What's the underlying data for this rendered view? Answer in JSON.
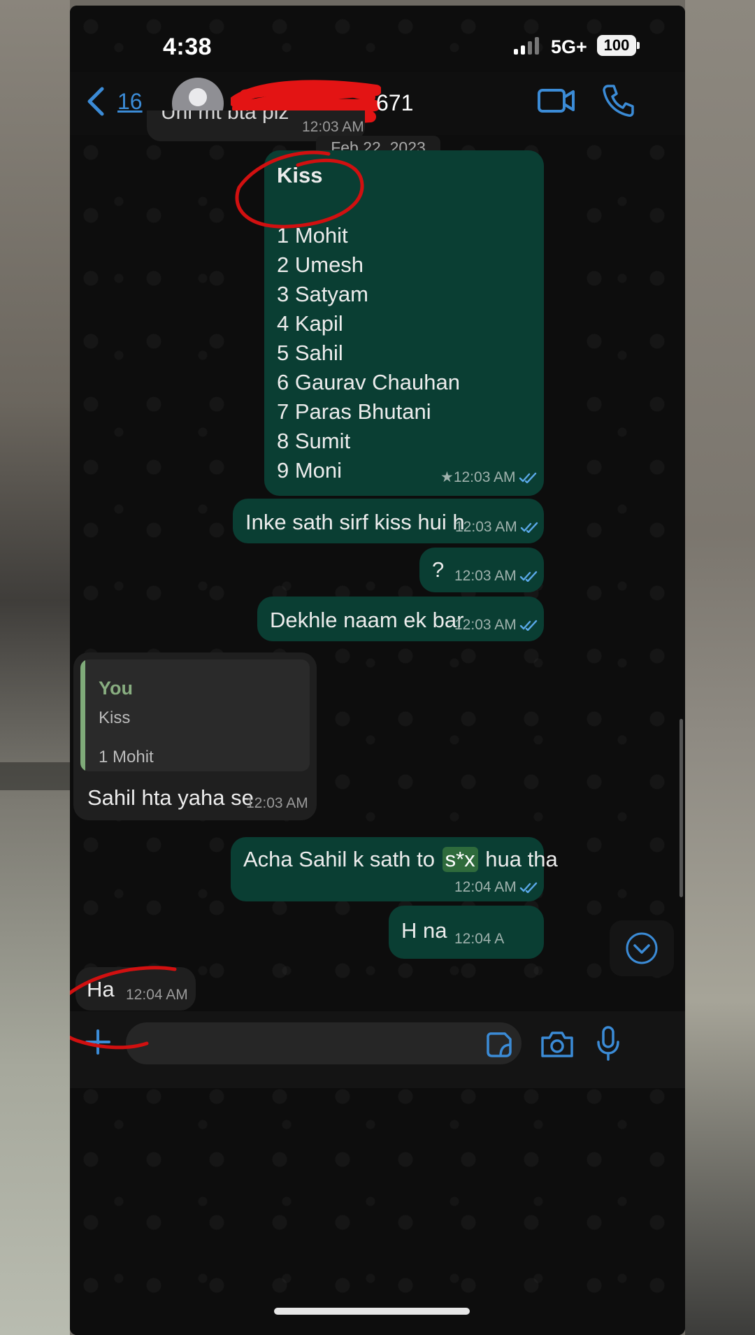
{
  "status_bar": {
    "time": "4:38",
    "network": "5G+",
    "battery": "100"
  },
  "header": {
    "back_count": "16",
    "contact_name_suffix": "671"
  },
  "previous_message": {
    "text": "Uhi mt bta plz",
    "time": "12:03 AM"
  },
  "date_chip": "Feb 22, 2023",
  "messages": {
    "list": {
      "title": "Kiss",
      "lines": [
        "1 Mohit",
        "2 Umesh",
        "3 Satyam",
        "4 Kapil",
        "5 Sahil",
        "6 Gaurav Chauhan",
        "7 Paras Bhutani",
        "8 Sumit",
        "9 Moni"
      ],
      "time": "★12:03 AM"
    },
    "m1": {
      "text": "Inke sath sirf kiss hui h",
      "time": "12:03 AM"
    },
    "m2": {
      "text": "?",
      "time": "12:03 AM"
    },
    "m3": {
      "text": "Dekhle naam ek bar",
      "time": "12:03 AM"
    },
    "reply": {
      "quote_author": "You",
      "quote_line1": "Kiss",
      "quote_line2": "1 Mohit",
      "text": "Sahil hta yaha se",
      "time": "12:03 AM"
    },
    "m4": {
      "text_before": "Acha Sahil k sath to ",
      "text_censored": "s*x",
      "text_after": " hua tha",
      "time": "12:04 AM"
    },
    "m5": {
      "text": "H na",
      "time": "12:04 A"
    },
    "m6": {
      "text": "Ha",
      "time": "12:04 AM"
    }
  },
  "colors": {
    "outgoing_bubble": "#0a3e33",
    "incoming_bubble": "#1f1f1f",
    "accent_blue": "#3b8bd6",
    "read_tick_blue": "#5aa8e8",
    "annotation_red": "#d11010"
  },
  "icons": [
    "back-chevron-icon",
    "avatar-icon",
    "video-call-icon",
    "phone-call-icon",
    "double-tick-icon",
    "scroll-down-icon",
    "plus-icon",
    "sticker-icon",
    "camera-icon",
    "mic-icon"
  ]
}
